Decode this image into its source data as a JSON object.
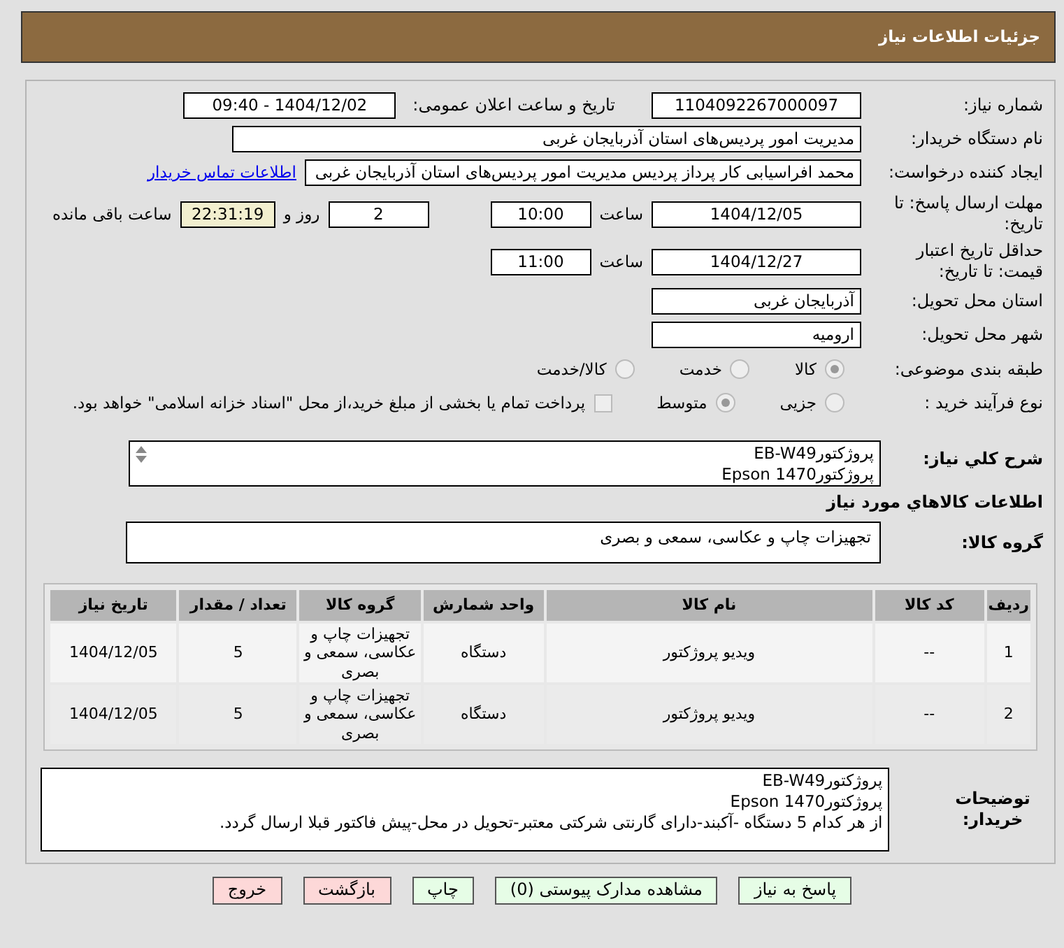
{
  "header": {
    "title": "جزئیات اطلاعات نیاز"
  },
  "need_number": {
    "label": "شماره نیاز:",
    "value": "1104092267000097"
  },
  "announce": {
    "label": "تاریخ و ساعت اعلان عمومی:",
    "value": "1404/12/02 - 09:40"
  },
  "buyer": {
    "label": "نام دستگاه خریدار:",
    "value": "مدیریت امور پردیس‌های استان آذربایجان غربی"
  },
  "requester": {
    "label": "ایجاد کننده درخواست:",
    "value": "محمد افراسیابی کار پرداز پردیس مدیریت امور پردیس‌های استان آذربایجان غربی",
    "link": "اطلاعات تماس خریدار"
  },
  "reply_deadline": {
    "label": "مهلت ارسال پاسخ: تا تاریخ:",
    "date": "1404/12/05",
    "time_label": "ساعت",
    "time": "10:00",
    "days": "2",
    "days_label": "روز و",
    "remaining": "22:31:19",
    "remaining_label": "ساعت باقی مانده"
  },
  "price_validity": {
    "label": "حداقل تاریخ اعتبار قیمت: تا تاریخ:",
    "date": "1404/12/27",
    "time_label": "ساعت",
    "time": "11:00"
  },
  "province": {
    "label": "استان محل تحویل:",
    "value": "آذربایجان غربی"
  },
  "city": {
    "label": "شهر محل تحویل:",
    "value": "ارومیه"
  },
  "category": {
    "label": "طبقه بندی موضوعی:",
    "options": [
      {
        "label": "کالا",
        "selected": true
      },
      {
        "label": "خدمت",
        "selected": false
      },
      {
        "label": "کالا/خدمت",
        "selected": false
      }
    ]
  },
  "purchase_type": {
    "label": "نوع فرآیند خرید :",
    "options": [
      {
        "label": "جزیی",
        "selected": false
      },
      {
        "label": "متوسط",
        "selected": true
      }
    ],
    "payment": {
      "checked": false,
      "text": "پرداخت تمام یا بخشی از مبلغ خرید،از محل \"اسناد خزانه اسلامی\" خواهد بود."
    }
  },
  "description": {
    "label": "شرح کلي نياز:",
    "lines": [
      "پروژکتورEB-W49",
      "پروژکتورEpson 1470"
    ]
  },
  "goods_heading": "اطلاعات کالاهاي مورد نياز",
  "goods_group": {
    "label": "گروه کالا:",
    "value": "تجهیزات چاپ و عکاسی، سمعی و بصری"
  },
  "table": {
    "columns": [
      "ردیف",
      "کد کالا",
      "نام کالا",
      "واحد شمارش",
      "گروه کالا",
      "تعداد / مقدار",
      "تاریخ نیاز"
    ],
    "rows": [
      [
        "1",
        "--",
        "ویدیو پروژکتور",
        "دستگاه",
        "تجهیزات چاپ و عکاسی، سمعی و بصری",
        "5",
        "1404/12/05"
      ],
      [
        "2",
        "--",
        "ویدیو پروژکتور",
        "دستگاه",
        "تجهیزات چاپ و عکاسی، سمعی و بصری",
        "5",
        "1404/12/05"
      ]
    ]
  },
  "buyer_notes": {
    "label": "توضیحات خریدار:",
    "lines": [
      "پروژکتورEB-W49",
      "پروژکتورEpson 1470",
      "از هر کدام 5 دستگاه -آکبند-دارای گارنتی شرکتی معتبر-تحویل در محل-پیش فاکتور قبلا ارسال گردد."
    ]
  },
  "buttons": [
    {
      "label": "پاسخ به نیاز",
      "kind": "ok"
    },
    {
      "label": "مشاهده مدارک پیوستی (0)",
      "kind": "ok"
    },
    {
      "label": "چاپ",
      "kind": "ok"
    },
    {
      "label": "بازگشت",
      "kind": "danger"
    },
    {
      "label": "خروج",
      "kind": "danger"
    }
  ]
}
